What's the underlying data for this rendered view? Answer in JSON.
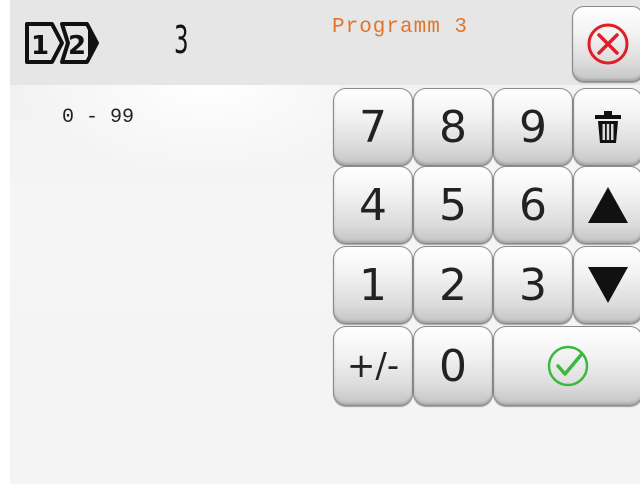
{
  "header": {
    "value": "3",
    "program_label": "Programm 3"
  },
  "input": {
    "range": "0 - 99"
  },
  "keypad": {
    "keys": [
      "7",
      "8",
      "9",
      "4",
      "5",
      "6",
      "1",
      "2",
      "3",
      "+/-",
      "0"
    ]
  },
  "colors": {
    "program_text": "#e0762c",
    "cancel": "#e01e2a",
    "confirm": "#3cb840"
  },
  "icons": {
    "sequence": "sequence-1-2-icon",
    "cancel": "cancel-x-icon",
    "delete": "trash-icon",
    "up": "triangle-up-icon",
    "down": "triangle-down-icon",
    "confirm": "check-icon"
  }
}
